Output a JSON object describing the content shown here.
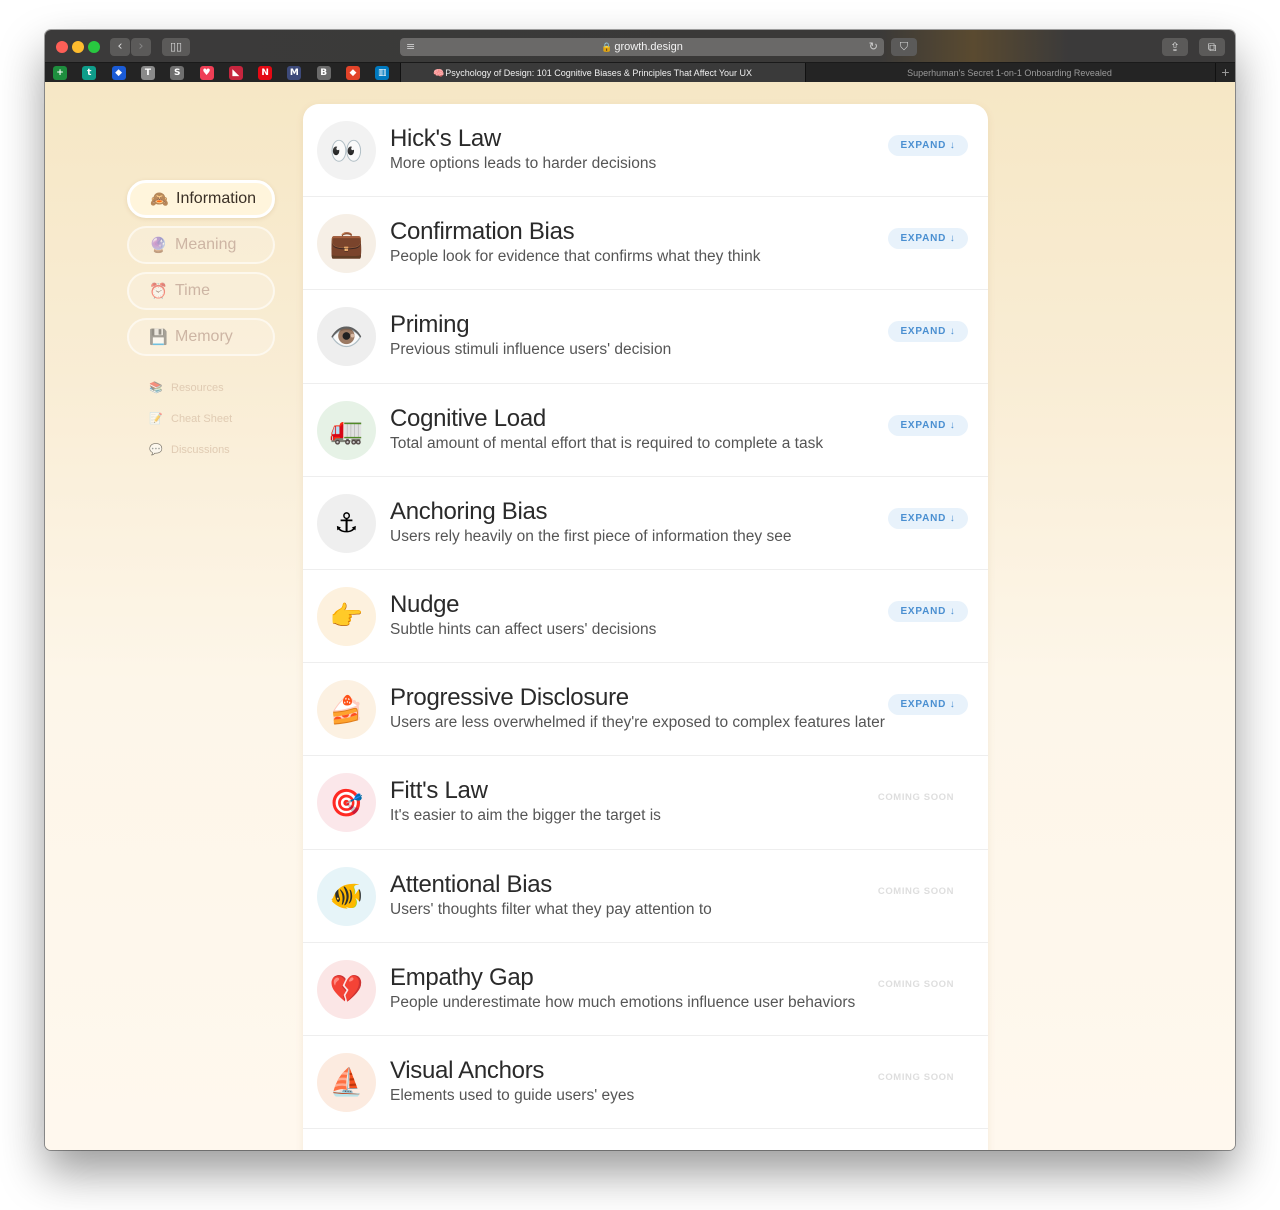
{
  "browser": {
    "address": "growth.design",
    "lock_icon": "lock-icon",
    "reader_icon": "reader-icon",
    "reload_icon": "reload-icon",
    "favicons": [
      {
        "name": "sheets-favicon",
        "glyph": "+",
        "color": "#1e8e3e"
      },
      {
        "name": "trello-t-favicon",
        "glyph": "t",
        "color": "#0f9d8a"
      },
      {
        "name": "diamond-favicon",
        "glyph": "◆",
        "color": "#1a5bd6"
      },
      {
        "name": "bitwarden-favicon",
        "glyph": "T",
        "color": "#8a8a8a"
      },
      {
        "name": "s-favicon",
        "glyph": "S",
        "color": "#6f6f6f"
      },
      {
        "name": "pocket-favicon",
        "glyph": "♥",
        "color": "#ef3f56"
      },
      {
        "name": "bird-favicon",
        "glyph": "◣",
        "color": "#c7253e"
      },
      {
        "name": "netflix-favicon",
        "glyph": "N",
        "color": "#e50914"
      },
      {
        "name": "mail-favicon",
        "glyph": "M",
        "color": "#3d4a7a"
      },
      {
        "name": "b-favicon",
        "glyph": "B",
        "color": "#6a6a6a"
      },
      {
        "name": "gitlab-favicon",
        "glyph": "◆",
        "color": "#e24329"
      },
      {
        "name": "trello-favicon",
        "glyph": "▥",
        "color": "#0079bf"
      }
    ],
    "tabs": {
      "active": "Psychology of Design: 101 Cognitive Biases & Principles That Affect Your UX",
      "active_icon": "🧠",
      "inactive": "Superhuman's Secret 1-on-1 Onboarding Revealed",
      "new_tab": "+"
    }
  },
  "sidebar": {
    "categories": [
      {
        "label": "Information",
        "icon": "🙈",
        "active": true
      },
      {
        "label": "Meaning",
        "icon": "🔮",
        "active": false
      },
      {
        "label": "Time",
        "icon": "⏰",
        "active": false
      },
      {
        "label": "Memory",
        "icon": "💾",
        "active": false
      }
    ],
    "links": [
      {
        "label": "Resources",
        "icon": "📚"
      },
      {
        "label": "Cheat Sheet",
        "icon": "📝"
      },
      {
        "label": "Discussions",
        "icon": "💬"
      }
    ]
  },
  "principles": [
    {
      "title": "Hick's Law",
      "description": "More options leads to harder decisions",
      "icon": "👀",
      "icon_bg": "#f2f2f2",
      "action": "EXPAND ↓",
      "available": true
    },
    {
      "title": "Confirmation Bias",
      "description": "People look for evidence that confirms what they think",
      "icon": "💼",
      "icon_bg": "#f6efe6",
      "action": "EXPAND ↓",
      "available": true
    },
    {
      "title": "Priming",
      "description": "Previous stimuli influence users' decision",
      "icon": "👁️",
      "icon_bg": "#eeeeee",
      "action": "EXPAND ↓",
      "available": true
    },
    {
      "title": "Cognitive Load",
      "description": "Total amount of mental effort that is required to complete a task",
      "icon": "🚛",
      "icon_bg": "#e6f2e6",
      "action": "EXPAND ↓",
      "available": true
    },
    {
      "title": "Anchoring Bias",
      "description": "Users rely heavily on the first piece of information they see",
      "icon": "⚓",
      "icon_bg": "#efefef",
      "action": "EXPAND ↓",
      "available": true
    },
    {
      "title": "Nudge",
      "description": "Subtle hints can affect users' decisions",
      "icon": "👉",
      "icon_bg": "#fdf1de",
      "action": "EXPAND ↓",
      "available": true
    },
    {
      "title": "Progressive Disclosure",
      "description": "Users are less overwhelmed if they're exposed to complex features later",
      "icon": "🍰",
      "icon_bg": "#fcf1e2",
      "action": "EXPAND ↓",
      "available": true
    },
    {
      "title": "Fitt's Law",
      "description": "It's easier to aim the bigger the target is",
      "icon": "🎯",
      "icon_bg": "#fbe7ea",
      "action": "COMING SOON",
      "available": false
    },
    {
      "title": "Attentional Bias",
      "description": "Users' thoughts filter what they pay attention to",
      "icon": "🐠",
      "icon_bg": "#e6f4f8",
      "action": "COMING SOON",
      "available": false
    },
    {
      "title": "Empathy Gap",
      "description": "People underestimate how much emotions influence user behaviors",
      "icon": "💔",
      "icon_bg": "#fbe6e6",
      "action": "COMING SOON",
      "available": false
    },
    {
      "title": "Visual Anchors",
      "description": "Elements used to guide users' eyes",
      "icon": "⛵",
      "icon_bg": "#fcebe0",
      "action": "COMING SOON",
      "available": false
    }
  ]
}
